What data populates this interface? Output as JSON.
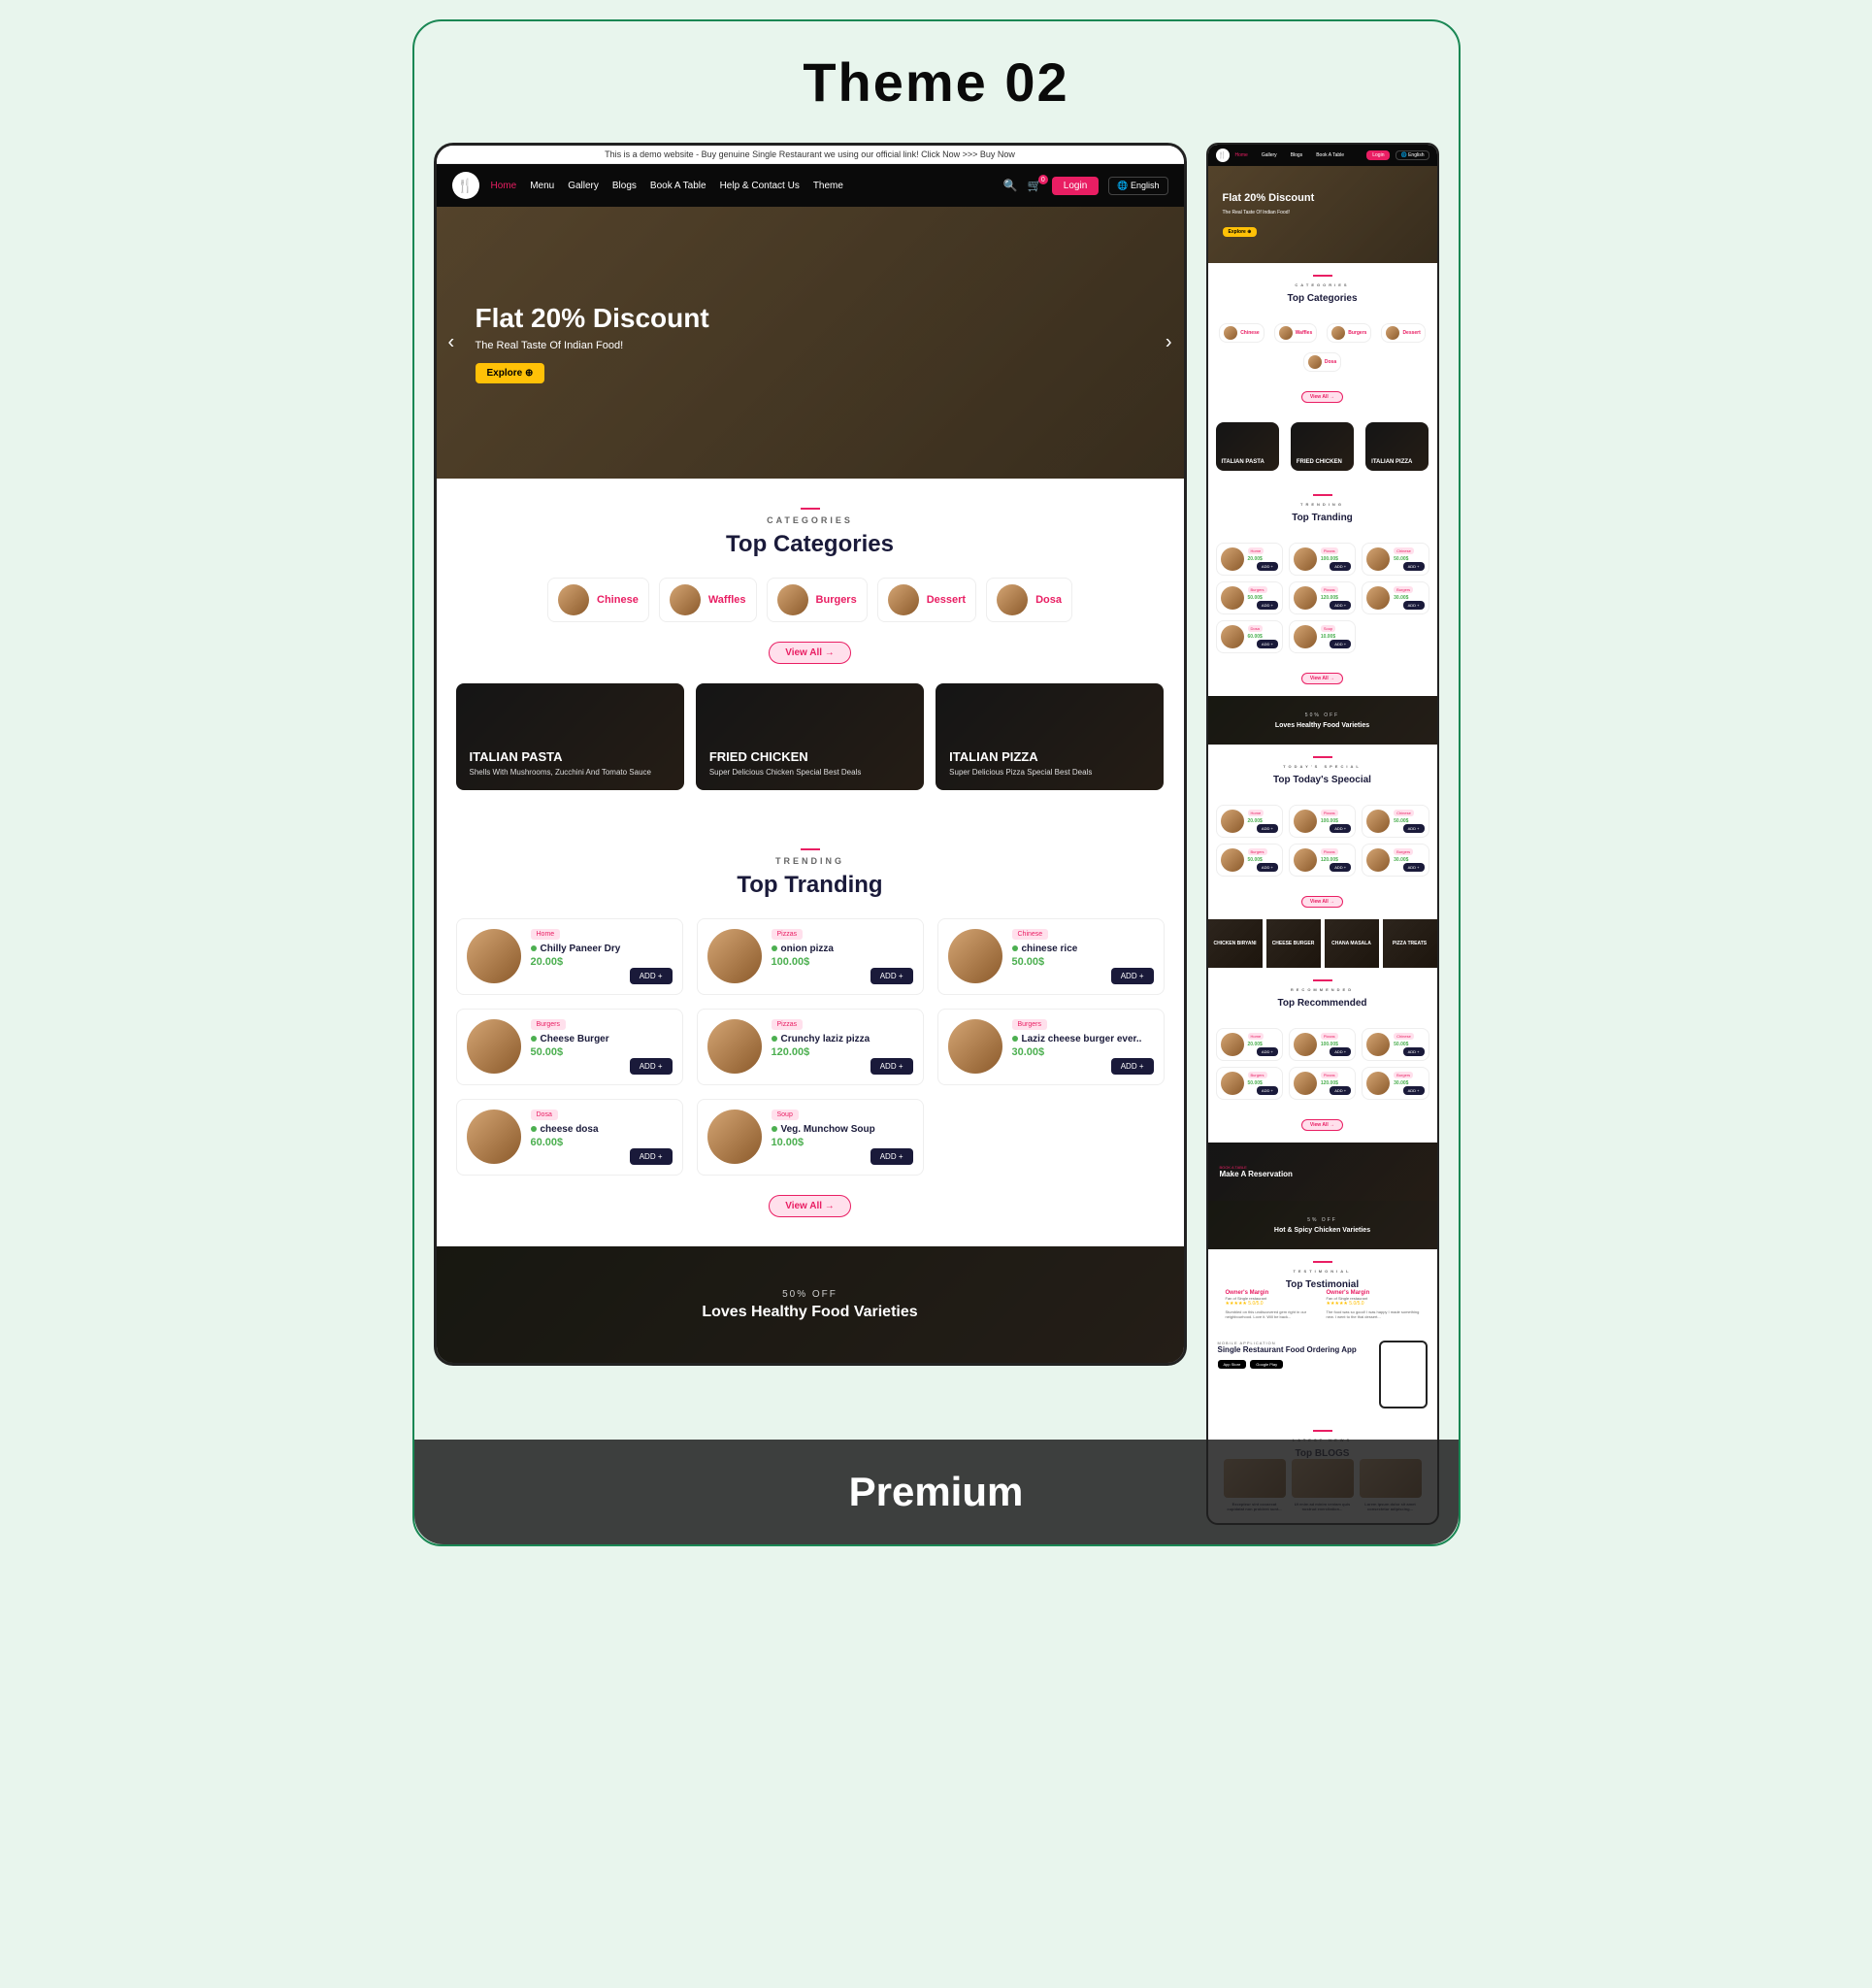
{
  "theme_title": "Theme 02",
  "premium_label": "Premium",
  "demo_banner": "This is a demo website - Buy genuine Single Restaurant we using our official link! Click Now >>> Buy Now",
  "nav": {
    "items": [
      "Home",
      "Menu",
      "Gallery",
      "Blogs",
      "Book A Table",
      "Help & Contact Us",
      "Theme"
    ],
    "login": "Login",
    "language": "🌐 English",
    "cart_count": "0"
  },
  "hero": {
    "title": "Flat 20% Discount",
    "subtitle": "The Real Taste Of Indian Food!",
    "cta": "Explore ⊕"
  },
  "sections": {
    "categories": {
      "label": "CATEGORIES",
      "title": "Top Categories",
      "view_all": "View All →"
    },
    "trending": {
      "label": "TRENDING",
      "title": "Top Tranding",
      "view_all": "View All →"
    },
    "specials": {
      "label": "TODAY'S SPECIAL",
      "title": "Top Today's Speocial"
    },
    "recommended": {
      "label": "RECOMMENDED",
      "title": "Top Recommended"
    },
    "testimonial": {
      "label": "TESTIMONIAL",
      "title": "Top Testimonial"
    },
    "blogs": {
      "label": "LATEST NEWS",
      "title": "Top BLOGS"
    }
  },
  "categories": [
    {
      "name": "Chinese"
    },
    {
      "name": "Waffles"
    },
    {
      "name": "Burgers"
    },
    {
      "name": "Dessert"
    },
    {
      "name": "Dosa"
    }
  ],
  "feature_cards": [
    {
      "title": "ITALIAN PASTA",
      "sub": "Shells With Mushrooms, Zucchini And Tomato Sauce"
    },
    {
      "title": "FRIED CHICKEN",
      "sub": "Super Delicious Chicken Special Best Deals"
    },
    {
      "title": "ITALIAN PIZZA",
      "sub": "Super Delicious Pizza Special Best Deals"
    }
  ],
  "trending": [
    {
      "tag": "Home",
      "name": "Chilly Paneer Dry",
      "price": "20.00$",
      "add": "ADD +"
    },
    {
      "tag": "Pizzas",
      "name": "onion pizza",
      "price": "100.00$",
      "add": "ADD +"
    },
    {
      "tag": "Chinese",
      "name": "chinese rice",
      "price": "50.00$",
      "add": "ADD +"
    },
    {
      "tag": "Burgers",
      "name": "Cheese Burger",
      "price": "50.00$",
      "add": "ADD +"
    },
    {
      "tag": "Pizzas",
      "name": "Crunchy laziz pizza",
      "price": "120.00$",
      "add": "ADD +"
    },
    {
      "tag": "Burgers",
      "name": "Laziz cheese burger ever..",
      "price": "30.00$",
      "add": "ADD +"
    },
    {
      "tag": "Dosa",
      "name": "cheese dosa",
      "price": "60.00$",
      "add": "ADD +"
    },
    {
      "tag": "Soup",
      "name": "Veg. Munchow Soup",
      "price": "10.00$",
      "add": "ADD +"
    }
  ],
  "banner": {
    "off": "50% OFF",
    "text": "Loves Healthy Food Varieties"
  },
  "banner2": {
    "off": "5% OFF",
    "text": "Hot & Spicy Chicken Varieties"
  },
  "gallery": [
    "CHICKEN BIRYANI",
    "CHEESE BURGER",
    "CHANA MASALA",
    "PIZZA TREATS"
  ],
  "reservation": {
    "label": "BOOK A TABLE",
    "title": "Make A Reservation"
  },
  "testimonials": [
    {
      "name": "Owner's Margin",
      "role": "Fan of Single restaurant",
      "rating": "★★★★★ 5.0/5.0",
      "text": "Stumbled on this undiscovered gem right in our neighbourhood. Love it. Will be back..."
    },
    {
      "name": "Owner's Margin",
      "role": "Fan of Single restaurant",
      "rating": "★★★★★ 5.0/5.0",
      "text": "The food was so good! I was happy I made something new. I went to the thai dessert..."
    }
  ],
  "app": {
    "label": "MOBILE APPLICATION",
    "title": "Single Restaurant Food Ordering App",
    "stores": [
      "App Store",
      "Google Play"
    ]
  },
  "blogs": [
    {
      "title": "Excepteur sint occaecat cupidatat non proident sunt..."
    },
    {
      "title": "Ut enim ad minim veniam quis nostrud exercitation..."
    },
    {
      "title": "Lorem ipsum dolor sit amet consectetur adipiscing..."
    }
  ]
}
